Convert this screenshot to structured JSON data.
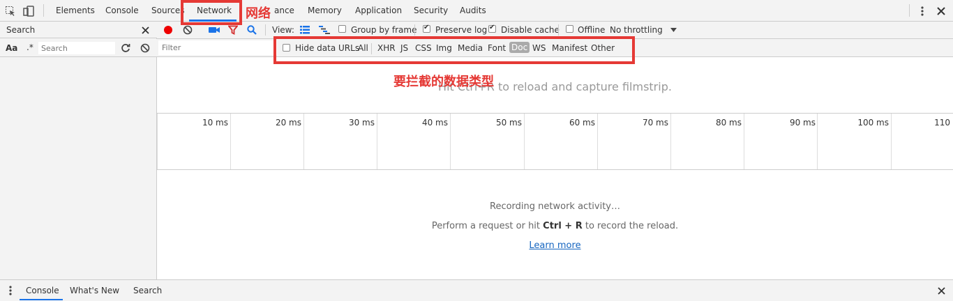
{
  "tabs": {
    "items": [
      "Elements",
      "Console",
      "Sources",
      "Network",
      "Performance",
      "Memory",
      "Application",
      "Security",
      "Audits"
    ],
    "performance_visible": "ance",
    "sources_visible": "Sources"
  },
  "left": {
    "header": "Search",
    "case_btn": "Aa",
    "regex_btn": ".*",
    "search_placeholder": "Search"
  },
  "toolbar": {
    "view_label": "View:",
    "group_by_frame": "Group by frame",
    "preserve_log": "Preserve log",
    "disable_cache": "Disable cache",
    "offline": "Offline",
    "throttling": "No throttling",
    "filter_placeholder": "Filter",
    "hide_data_urls": "Hide data URLs",
    "filter_types": [
      "All",
      "XHR",
      "JS",
      "CSS",
      "Img",
      "Media",
      "Font",
      "Doc",
      "WS",
      "Manifest",
      "Other"
    ],
    "active_type": "Doc"
  },
  "main": {
    "hint": "Hit Ctrl+R to reload and capture filmstrip.",
    "timeline_labels": [
      "10 ms",
      "20 ms",
      "30 ms",
      "40 ms",
      "50 ms",
      "60 ms",
      "70 ms",
      "80 ms",
      "90 ms",
      "100 ms",
      "110"
    ],
    "recording": "Recording network activity…",
    "perform_prefix": "Perform a request or hit ",
    "perform_keys": "Ctrl + R",
    "perform_suffix": " to record the reload.",
    "learn_more": "Learn more"
  },
  "drawer": {
    "tabs": [
      "Console",
      "What's New",
      "Search"
    ]
  },
  "annotations": {
    "network_label": "网络",
    "filter_label": "要拦截的数据类型",
    "color": "#e53935"
  }
}
